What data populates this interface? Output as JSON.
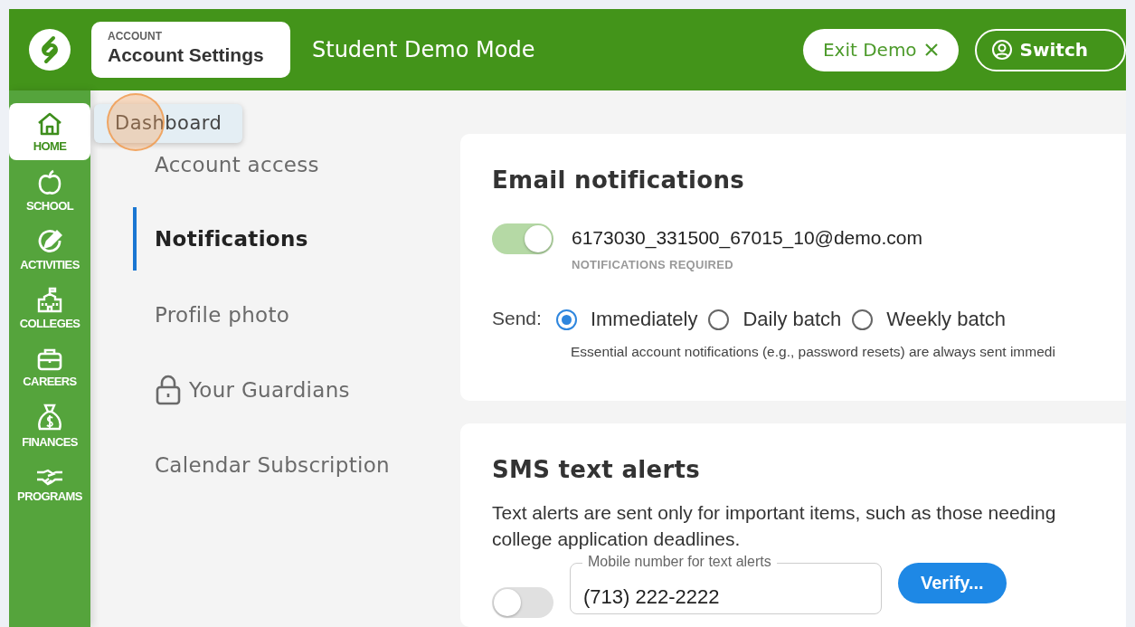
{
  "header": {
    "breadcrumb": {
      "section": "ACCOUNT",
      "title": "Account Settings"
    },
    "title": "Student Demo Mode",
    "buttons": [
      {
        "kind": "filled",
        "label": "Exit Demo"
      },
      {
        "kind": "outline",
        "label": "Switch"
      }
    ]
  },
  "nav": [
    {
      "label": "HOME",
      "selected": true
    },
    {
      "label": "SCHOOL",
      "selected": false
    },
    {
      "label": "ACTIVITIES",
      "selected": false
    },
    {
      "label": "COLLEGES",
      "selected": false
    },
    {
      "label": "CAREERS",
      "selected": false
    },
    {
      "label": "FINANCES",
      "selected": false
    },
    {
      "label": "PROGRAMS",
      "selected": false
    }
  ],
  "tooltip": "Dashboard",
  "settings_menu": [
    {
      "label": "Account access",
      "selected": false,
      "locked": false
    },
    {
      "label": "Notifications",
      "selected": true,
      "locked": false
    },
    {
      "label": "Profile photo",
      "selected": false,
      "locked": false
    },
    {
      "label": "Your Guardians",
      "selected": false,
      "locked": true
    },
    {
      "label": "Calendar Subscription",
      "selected": false,
      "locked": false
    }
  ],
  "email": {
    "title": "Email notifications",
    "toggle": {
      "on": true
    },
    "address": "6173030_331500_67015_10@demo.com",
    "note": "NOTIFICATIONS REQUIRED",
    "send_label": "Send:",
    "options": [
      {
        "label": "Immediately",
        "selected": true
      },
      {
        "label": "Daily batch",
        "selected": false
      },
      {
        "label": "Weekly batch",
        "selected": false
      }
    ],
    "helper": "Essential account notifications (e.g., password resets) are always sent immedi"
  },
  "sms": {
    "title": "SMS text alerts",
    "description": [
      "Text alerts are sent only for important items, such as those needing",
      "college application deadlines."
    ],
    "toggle": {
      "on": false
    },
    "field": {
      "label": "Mobile number for text alerts",
      "value": "(713) 222-2222"
    },
    "button": "Verify..."
  }
}
